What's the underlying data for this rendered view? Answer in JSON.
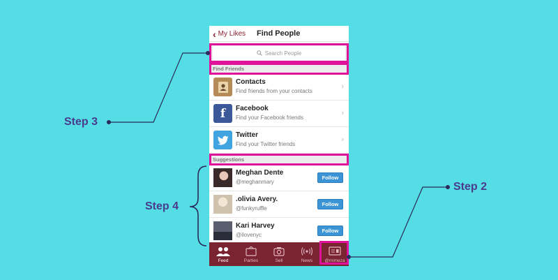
{
  "header": {
    "back_label": "My Likes",
    "title": "Find People"
  },
  "search": {
    "placeholder": "Search People"
  },
  "sections": {
    "find_friends": "Find Friends",
    "suggestions": "Suggestions"
  },
  "find_rows": [
    {
      "name": "Contacts",
      "sub": "Find friends from your contacts",
      "icon": "contacts-book-icon"
    },
    {
      "name": "Facebook",
      "sub": "Find your Facebook friends",
      "icon": "facebook-icon"
    },
    {
      "name": "Twitter",
      "sub": "Find your Twitter friends",
      "icon": "twitter-icon"
    }
  ],
  "suggestions": [
    {
      "name": "Meghan Dente",
      "handle": "@meghanmary",
      "button": "Follow"
    },
    {
      "name": ".olivia Avery.",
      "handle": "@funkyruffle",
      "button": "Follow"
    },
    {
      "name": "Kari Harvey",
      "handle": "@ilovenyc",
      "button": "Follow"
    }
  ],
  "tabs": [
    {
      "label": "Feed",
      "icon": "people-icon",
      "active": true
    },
    {
      "label": "Parties",
      "icon": "parties-icon",
      "active": false
    },
    {
      "label": "Sell",
      "icon": "camera-icon",
      "active": false
    },
    {
      "label": "News",
      "icon": "broadcast-icon",
      "active": false
    },
    {
      "label": "@mimeza",
      "icon": "profile-card-icon",
      "active": false
    }
  ],
  "annotations": {
    "step2": "Step 2",
    "step3": "Step 3",
    "step4": "Step 4"
  },
  "colors": {
    "background": "#55dde6",
    "highlight": "#e0119b",
    "brand": "#7a2331",
    "follow": "#3a94d6",
    "step_text": "#4a3a8c"
  }
}
